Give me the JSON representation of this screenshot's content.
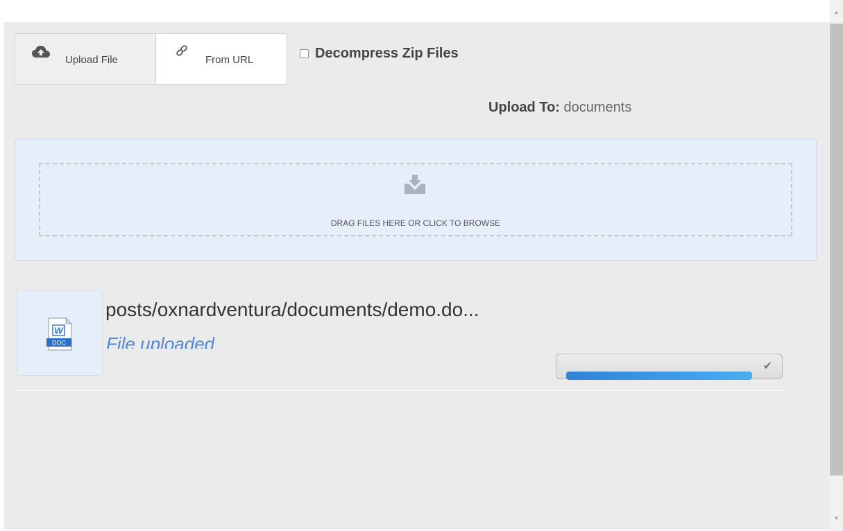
{
  "tabs": {
    "upload_file_label": "Upload File",
    "upload_file_icon": "cloud-upload-icon",
    "from_url_label": "From URL",
    "from_url_icon": "link-icon"
  },
  "decompress": {
    "label": "Decompress Zip Files",
    "checked": false
  },
  "upload_to": {
    "label": "Upload To:",
    "value": "documents"
  },
  "dropzone": {
    "icon": "inbox-download-icon",
    "text": "DRAG FILES HERE OR CLICK TO BROWSE"
  },
  "file": {
    "icon": "word-doc-icon",
    "icon_badge": "DOC",
    "icon_letter": "W",
    "name": "posts/oxnardventura/documents/demo.do...",
    "status": "File uploaded",
    "progress": 1.0
  },
  "colors": {
    "panel_bg": "#ebebeb",
    "dropzone_bg": "#e6eefa",
    "status_blue": "#4f86d6",
    "progress_blue": "#2f82d8"
  },
  "scrollbar": {
    "up_arrow": "▲",
    "down_arrow": "▼"
  }
}
